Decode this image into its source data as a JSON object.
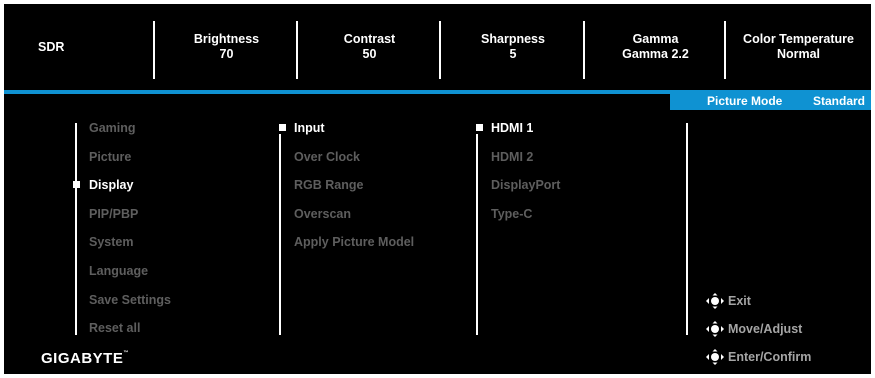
{
  "topbar": {
    "mode": "SDR",
    "brightness": {
      "label": "Brightness",
      "value": "70"
    },
    "contrast": {
      "label": "Contrast",
      "value": "50"
    },
    "sharpness": {
      "label": "Sharpness",
      "value": "5"
    },
    "gamma": {
      "label": "Gamma",
      "value": "Gamma 2.2"
    },
    "color_temp": {
      "label": "Color Temperature",
      "value": "Normal"
    }
  },
  "picture_mode": {
    "label": "Picture Mode",
    "value": "Standard"
  },
  "menu": {
    "main": [
      "Gaming",
      "Picture",
      "Display",
      "PIP/PBP",
      "System",
      "Language",
      "Save Settings",
      "Reset all"
    ],
    "main_active": "Display",
    "sub": [
      "Input",
      "Over Clock",
      "RGB Range",
      "Overscan",
      "Apply Picture Model"
    ],
    "sub_active": "Input",
    "options": [
      "HDMI 1",
      "HDMI 2",
      "DisplayPort",
      "Type-C"
    ],
    "options_active": "HDMI 1"
  },
  "hints": {
    "exit": "Exit",
    "move": "Move/Adjust",
    "enter": "Enter/Confirm"
  },
  "brand": {
    "logo": "GIGABYTE",
    "trademark": "™"
  },
  "colors": {
    "accent": "#0f92d2",
    "inactive": "#5e5e5e",
    "hint": "#a5a5a5",
    "background": "#000000"
  },
  "icons": {
    "joystick": "joystick-icon",
    "bullet": "selection-bullet"
  }
}
